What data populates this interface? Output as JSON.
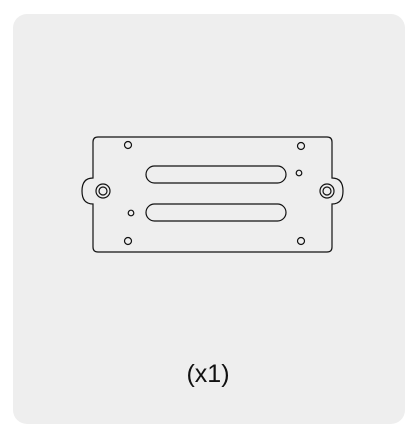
{
  "part": {
    "icon": "mounting-plate-icon",
    "quantity_label": "(x1)"
  },
  "colors": {
    "card_background": "#eeeeee",
    "page_background": "#ffffff",
    "line": "#111111"
  }
}
